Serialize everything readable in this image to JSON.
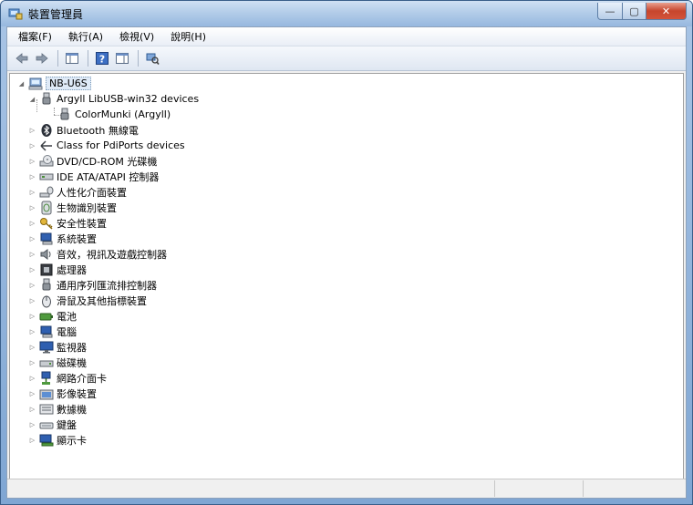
{
  "window": {
    "title": "裝置管理員",
    "controls": {
      "minimize": "—",
      "maximize": "▢",
      "close": "✕"
    }
  },
  "menu": [
    {
      "label": "檔案(F)"
    },
    {
      "label": "執行(A)"
    },
    {
      "label": "檢視(V)"
    },
    {
      "label": "說明(H)"
    }
  ],
  "toolbar": {
    "buttons": [
      {
        "name": "back-button",
        "icon": "back-arrow-icon"
      },
      {
        "name": "forward-button",
        "icon": "forward-arrow-icon"
      },
      {
        "name": "show-hide-console-tree-button",
        "icon": "console-tree-icon"
      },
      {
        "name": "help-button",
        "icon": "help-icon"
      },
      {
        "name": "properties-button",
        "icon": "properties-icon"
      },
      {
        "name": "scan-hardware-button",
        "icon": "scan-hardware-icon"
      }
    ]
  },
  "tree": {
    "root": {
      "label": "NB-U6S",
      "icon": "computer-icon",
      "expanded": true
    },
    "nodes": [
      {
        "label": "Argyll LibUSB-win32 devices",
        "icon": "usb-plug-icon",
        "expanded": true,
        "children": [
          {
            "label": "ColorMunki (Argyll)",
            "icon": "usb-plug-icon"
          }
        ]
      },
      {
        "label": "Bluetooth 無線電",
        "icon": "bluetooth-icon"
      },
      {
        "label": "Class for PdiPorts devices",
        "icon": "pdiports-icon"
      },
      {
        "label": "DVD/CD-ROM 光碟機",
        "icon": "dvd-drive-icon"
      },
      {
        "label": "IDE ATA/ATAPI 控制器",
        "icon": "ide-controller-icon"
      },
      {
        "label": "人性化介面裝置",
        "icon": "hid-icon"
      },
      {
        "label": "生物識別裝置",
        "icon": "biometric-icon"
      },
      {
        "label": "安全性裝置",
        "icon": "security-key-icon"
      },
      {
        "label": "系統裝置",
        "icon": "system-device-icon"
      },
      {
        "label": "音效，視訊及遊戲控制器",
        "icon": "sound-icon"
      },
      {
        "label": "處理器",
        "icon": "processor-icon"
      },
      {
        "label": "通用序列匯流排控制器",
        "icon": "usb-plug-icon"
      },
      {
        "label": "滑鼠及其他指標裝置",
        "icon": "mouse-icon"
      },
      {
        "label": "電池",
        "icon": "battery-icon"
      },
      {
        "label": "電腦",
        "icon": "computer-icon"
      },
      {
        "label": "監視器",
        "icon": "monitor-icon"
      },
      {
        "label": "磁碟機",
        "icon": "disk-drive-icon"
      },
      {
        "label": "網路介面卡",
        "icon": "network-adapter-icon"
      },
      {
        "label": "影像裝置",
        "icon": "imaging-device-icon"
      },
      {
        "label": "數據機",
        "icon": "modem-icon"
      },
      {
        "label": "鍵盤",
        "icon": "keyboard-icon"
      },
      {
        "label": "顯示卡",
        "icon": "display-adapter-icon"
      }
    ]
  },
  "colors": {
    "title_gradient_top": "#cfe0f3",
    "selection_fill": "#dfeaf7",
    "close_button": "#c7452c"
  }
}
